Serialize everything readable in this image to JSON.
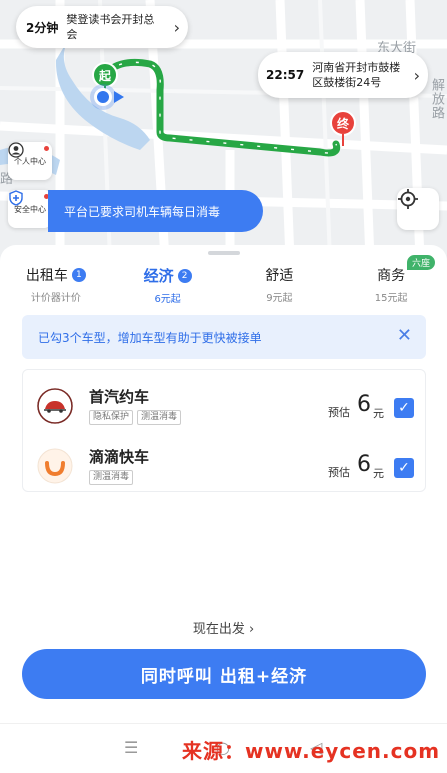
{
  "map": {
    "roads": [
      "东大街",
      "解放路",
      "路"
    ],
    "start_bubble": {
      "time": "2分钟",
      "place": "樊登读书会开封总会"
    },
    "end_bubble": {
      "time": "22:57",
      "place": "河南省开封市鼓楼区鼓楼街24号"
    },
    "start_pin": "起",
    "end_pin": "终",
    "personal_center": "个人中心",
    "safety_center": "安全中心",
    "notice": "平台已要求司机车辆每日消毒",
    "route_color": "#27a745"
  },
  "tabs": [
    {
      "name": "出租车",
      "badge": "1",
      "sub": "计价器计价",
      "active": false,
      "tag": ""
    },
    {
      "name": "经济",
      "badge": "2",
      "sub": "6元起",
      "active": true,
      "tag": ""
    },
    {
      "name": "舒适",
      "badge": "",
      "sub": "9元起",
      "active": false,
      "tag": ""
    },
    {
      "name": "商务",
      "badge": "",
      "sub": "15元起",
      "active": false,
      "tag": "六座"
    }
  ],
  "hint": "已勾3个车型，增加车型有助于更快被接单",
  "cars": [
    {
      "name": "首汽约车",
      "tags": [
        "隐私保护",
        "测温消毒"
      ],
      "est_label": "预估",
      "price": "6",
      "unit": "元",
      "checked": true,
      "logo": "shouqi-logo"
    },
    {
      "name": "滴滴快车",
      "tags": [
        "测温消毒"
      ],
      "est_label": "预估",
      "price": "6",
      "unit": "元",
      "checked": true,
      "logo": "didi-logo"
    }
  ],
  "depart": "现在出发",
  "cta": "同时呼叫 出租+经济",
  "watermark": "来源：www.eycen.com",
  "colors": {
    "primary": "#3d7cf2",
    "route": "#27a745",
    "end": "#e8423c"
  }
}
